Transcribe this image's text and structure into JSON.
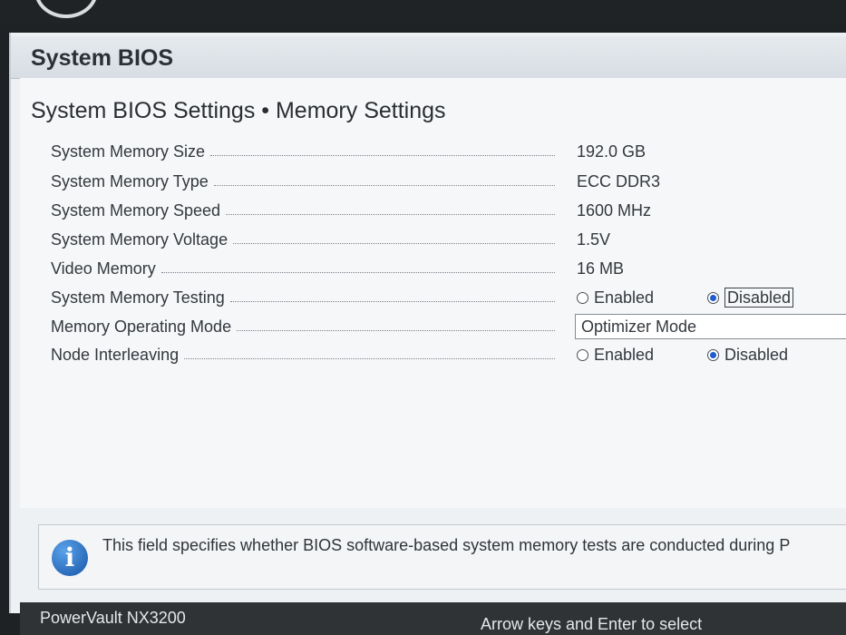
{
  "app": {
    "title": "System BIOS"
  },
  "page": {
    "title": "System BIOS Settings • Memory Settings"
  },
  "settings": [
    {
      "label": "System Memory Size",
      "value": "192.0 GB"
    },
    {
      "label": "System Memory Type",
      "value": "ECC DDR3"
    },
    {
      "label": "System Memory Speed",
      "value": "1600 MHz"
    },
    {
      "label": "System Memory Voltage",
      "value": "1.5V"
    },
    {
      "label": "Video Memory",
      "value": "16 MB"
    },
    {
      "label": "System Memory Testing",
      "options": [
        "Enabled",
        "Disabled"
      ],
      "selected": "Disabled"
    },
    {
      "label": "Memory Operating Mode",
      "value": "Optimizer Mode"
    },
    {
      "label": "Node Interleaving",
      "options": [
        "Enabled",
        "Disabled"
      ],
      "selected": "Disabled"
    }
  ],
  "help": {
    "icon": "info-icon",
    "text": "This field specifies whether BIOS software-based system memory tests are conducted during P"
  },
  "status": {
    "model": "PowerVault NX3200",
    "hint": "Arrow keys and Enter to select"
  }
}
